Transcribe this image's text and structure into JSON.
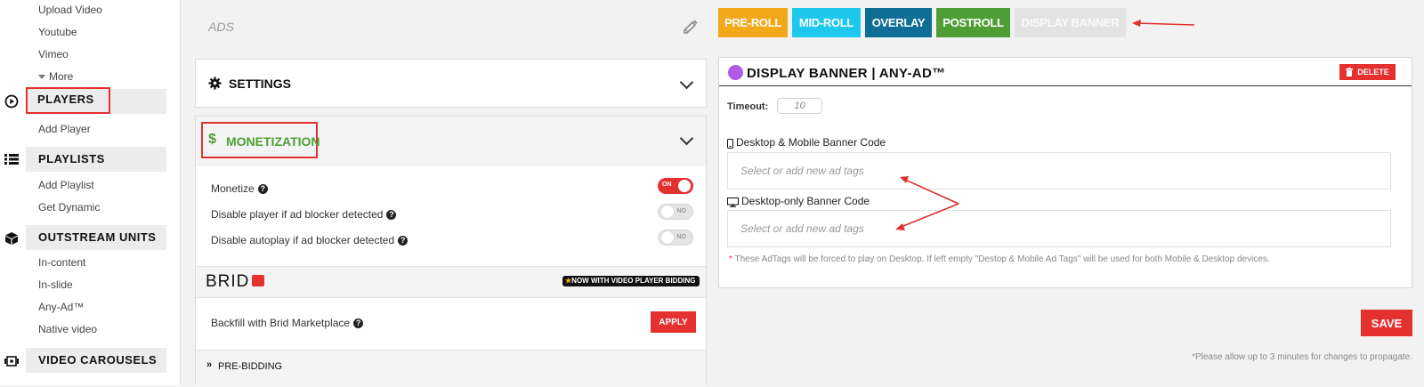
{
  "sidebar": {
    "top_items": [
      "Upload Video",
      "Youtube",
      "Vimeo",
      "More"
    ],
    "players": {
      "title": "PLAYERS",
      "items": [
        "Add Player"
      ]
    },
    "playlists": {
      "title": "PLAYLISTS",
      "items": [
        "Add Playlist",
        "Get Dynamic"
      ]
    },
    "outstream": {
      "title": "OUTSTREAM UNITS",
      "items": [
        "In-content",
        "In-slide",
        "Any-Ad™",
        "Native video"
      ]
    },
    "carousels": {
      "title": "VIDEO CAROUSELS"
    }
  },
  "center": {
    "ads_title": "ADS",
    "settings_label": "SETTINGS",
    "monetization_label": "MONETIZATION",
    "rows": [
      {
        "label": "Monetize",
        "state": "on",
        "toggle_text": "ON"
      },
      {
        "label": "Disable player if ad blocker detected",
        "state": "off",
        "toggle_text": "NO"
      },
      {
        "label": "Disable autoplay if ad blocker detected",
        "state": "off",
        "toggle_text": "NO"
      }
    ],
    "brid_logo": "BRID",
    "brid_badge": "NOW WITH VIDEO PLAYER BIDDING",
    "backfill_label": "Backfill with Brid Marketplace",
    "apply_label": "APPLY",
    "prebidding_label": "PRE-BIDDING"
  },
  "tabs": [
    {
      "label": "PRE-ROLL",
      "color": "#f2a818"
    },
    {
      "label": "MID-ROLL",
      "color": "#1ec8ec"
    },
    {
      "label": "OVERLAY",
      "color": "#0e6e96"
    },
    {
      "label": "POSTROLL",
      "color": "#4f9e35"
    },
    {
      "label": "DISPLAY BANNER",
      "color": "#e3e3e3"
    }
  ],
  "banner": {
    "title": "DISPLAY BANNER | ANY-AD™",
    "dot_color": "#b05be6",
    "delete_label": "DELETE",
    "timeout_label": "Timeout:",
    "timeout_value": "10",
    "desktop_mobile_label": "Desktop & Mobile Banner Code",
    "desktop_mobile_placeholder": "Select or add new ad tags",
    "desktop_only_label": "Desktop-only Banner Code",
    "desktop_only_placeholder": "Select or add new ad tags",
    "note": "These AdTags will be forced to play on Desktop. If left empty \"Destop & Mobile Ad Tags\" will be used for both Mobile & Desktop devices."
  },
  "save_label": "SAVE",
  "propagate_note": "*Please allow up to 3 minutes for changes to propagate."
}
